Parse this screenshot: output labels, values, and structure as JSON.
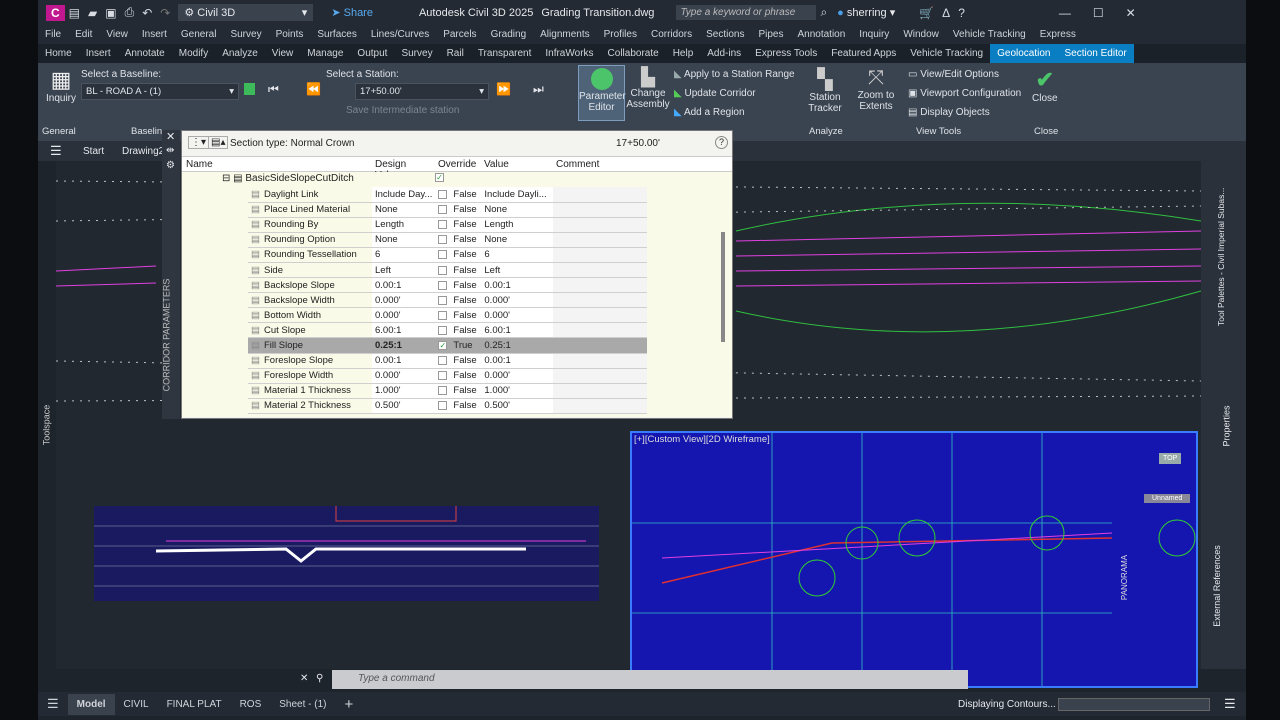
{
  "titlebar": {
    "app_letter": "C",
    "workspace": "Civil 3D",
    "share": "Share",
    "title": "Autodesk Civil 3D 2025",
    "file": "Grading Transition.dwg",
    "search_placeholder": "Type a keyword or phrase",
    "user": "sherring"
  },
  "menu": [
    "File",
    "Edit",
    "View",
    "Insert",
    "General",
    "Survey",
    "Points",
    "Surfaces",
    "Lines/Curves",
    "Parcels",
    "Grading",
    "Alignments",
    "Profiles",
    "Corridors",
    "Sections",
    "Pipes",
    "Annotation",
    "Inquiry",
    "Window",
    "Vehicle Tracking",
    "Express"
  ],
  "ribbon_tabs": [
    "Home",
    "Insert",
    "Annotate",
    "Modify",
    "Analyze",
    "View",
    "Manage",
    "Output",
    "Survey",
    "Rail",
    "Transparent",
    "InfraWorks",
    "Collaborate",
    "Help",
    "Add-ins",
    "Express Tools",
    "Featured Apps",
    "Vehicle Tracking",
    "Geolocation",
    "Section Editor"
  ],
  "ribbon": {
    "inquiry": "Inquiry",
    "baseline_label": "Select a Baseline:",
    "baseline_value": "BL - ROAD A - (1)",
    "station_label": "Select a Station:",
    "station_value": "17+50.00'",
    "save_intermediate": "Save Intermediate station",
    "parameter_editor": [
      "Parameter",
      "Editor"
    ],
    "change_assembly": [
      "Change",
      "Assembly"
    ],
    "apply_range": "Apply to a Station Range",
    "update_corridor": "Update Corridor",
    "add_region": "Add a Region",
    "station_tracker": [
      "Station",
      "Tracker"
    ],
    "zoom_extents": [
      "Zoom to",
      "Extents"
    ],
    "view_edit": "View/Edit Options",
    "viewport_config": "Viewport Configuration",
    "display_objects": "Display Objects",
    "close": "Close",
    "panels": [
      "General",
      "Baselin",
      "Analyze",
      "View Tools",
      "Close"
    ]
  },
  "drawing_tabs": [
    "Start",
    "Drawing2"
  ],
  "panel": {
    "section_type": "Section type:  Normal Crown",
    "station": "17+50.00'",
    "side_label": "CORRIDOR PARAMETERS",
    "columns": [
      "Name",
      "Design Value",
      "Override",
      "Value",
      "Comment"
    ],
    "group": "BasicSideSlopeCutDitch",
    "rows": [
      {
        "name": "Daylight Link",
        "design": "Include Day...",
        "override": "False",
        "checked": false,
        "value": "Include Dayli..."
      },
      {
        "name": "Place Lined Material",
        "design": "None",
        "override": "False",
        "checked": false,
        "value": "None"
      },
      {
        "name": "Rounding By",
        "design": "Length",
        "override": "False",
        "checked": false,
        "value": "Length"
      },
      {
        "name": "Rounding Option",
        "design": "None",
        "override": "False",
        "checked": false,
        "value": "None"
      },
      {
        "name": "Rounding Tessellation",
        "design": "6",
        "override": "False",
        "checked": false,
        "value": "6"
      },
      {
        "name": "Side",
        "design": "Left",
        "override": "False",
        "checked": false,
        "value": "Left"
      },
      {
        "name": "Backslope Slope",
        "design": "0.00:1",
        "override": "False",
        "checked": false,
        "value": "0.00:1"
      },
      {
        "name": "Backslope Width",
        "design": "0.000'",
        "override": "False",
        "checked": false,
        "value": "0.000'"
      },
      {
        "name": "Bottom Width",
        "design": "0.000'",
        "override": "False",
        "checked": false,
        "value": "0.000'"
      },
      {
        "name": "Cut Slope",
        "design": "6.00:1",
        "override": "False",
        "checked": false,
        "value": "6.00:1"
      },
      {
        "name": "Fill Slope",
        "design": "0.25:1",
        "override": "True",
        "checked": true,
        "value": "0.25:1"
      },
      {
        "name": "Foreslope Slope",
        "design": "0.00:1",
        "override": "False",
        "checked": false,
        "value": "0.00:1"
      },
      {
        "name": "Foreslope Width",
        "design": "0.000'",
        "override": "False",
        "checked": false,
        "value": "0.000'"
      },
      {
        "name": "Material 1 Thickness",
        "design": "1.000'",
        "override": "False",
        "checked": false,
        "value": "1.000'"
      },
      {
        "name": "Material 2 Thickness",
        "design": "0.500'",
        "override": "False",
        "checked": false,
        "value": "0.500'"
      }
    ]
  },
  "viewport": {
    "label": "[+][Custom View][2D Wireframe]",
    "panorama": "PANORAMA",
    "unnamed": "Unnamed",
    "top": "TOP"
  },
  "side_labels": {
    "toolspace": "Toolspace",
    "tool_palettes": "Tool Palettes - Civil Imperial Subas...",
    "properties": "Properties",
    "external_refs": "External References"
  },
  "command_placeholder": "Type a command",
  "layout_tabs": [
    "Model",
    "CIVIL",
    "FINAL PLAT",
    "ROS",
    "Sheet - (1)"
  ],
  "status_text": "Displaying Contours..."
}
